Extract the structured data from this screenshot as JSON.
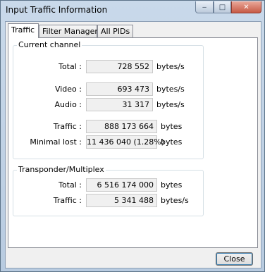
{
  "window": {
    "title": "Input Traffic Information",
    "controls": {
      "minimize": "‒",
      "maximize": "□",
      "close": "✕"
    }
  },
  "tabs": [
    {
      "label": "Traffic",
      "active": true
    },
    {
      "label": "Filter Manager",
      "active": false
    },
    {
      "label": "All PIDs",
      "active": false
    }
  ],
  "current_channel": {
    "legend": "Current channel",
    "total": {
      "label": "Total :",
      "value": "728 552",
      "unit": "bytes/s"
    },
    "video": {
      "label": "Video :",
      "value": "693 473",
      "unit": "bytes/s"
    },
    "audio": {
      "label": "Audio :",
      "value": "31 317",
      "unit": "bytes/s"
    },
    "traffic": {
      "label": "Traffic :",
      "value": "888 173 664",
      "unit": "bytes"
    },
    "minimal_lost": {
      "label": "Minimal lost :",
      "value": "11 436 040 (1.28%)",
      "unit": "bytes"
    }
  },
  "transponder": {
    "legend": "Transponder/Multiplex",
    "total": {
      "label": "Total :",
      "value": "6 516 174 000",
      "unit": "bytes"
    },
    "traffic": {
      "label": "Traffic :",
      "value": "5 341 488",
      "unit": "bytes/s"
    }
  },
  "footer": {
    "close_label": "Close"
  }
}
